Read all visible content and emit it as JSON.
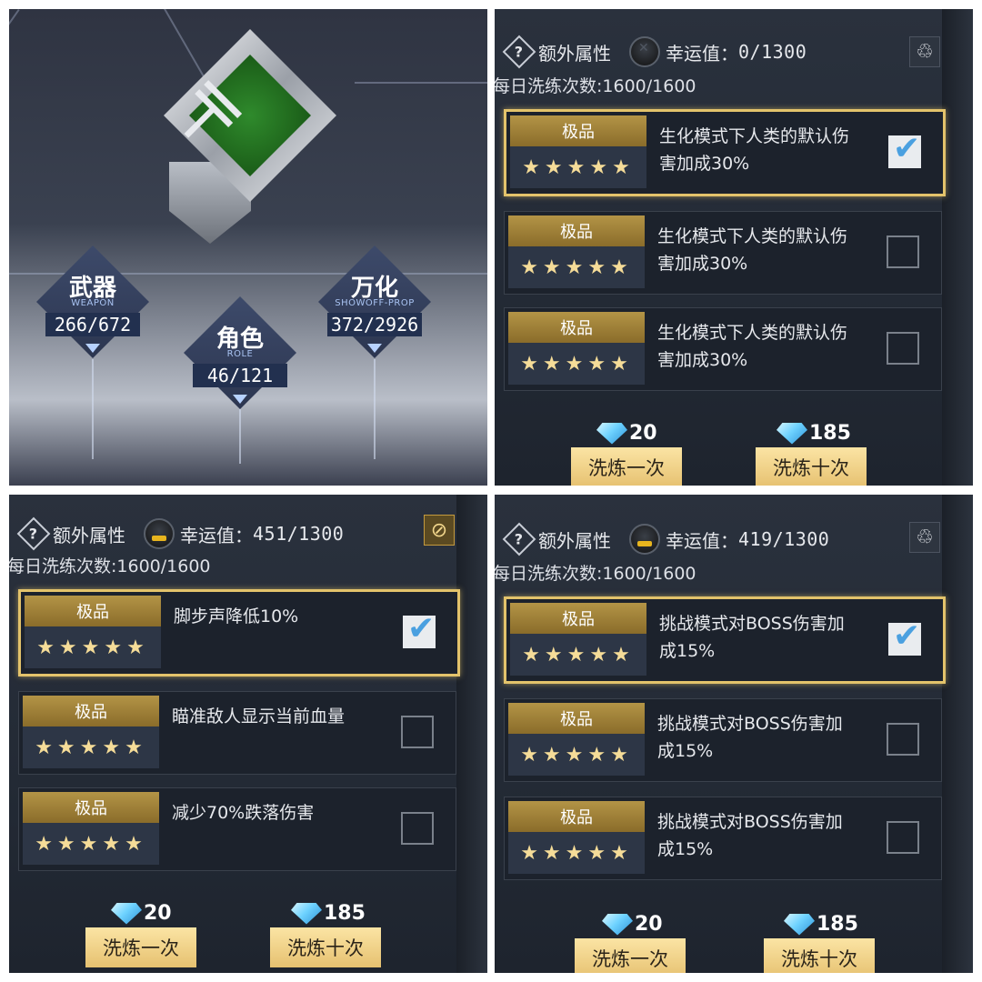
{
  "showcase": {
    "categories": [
      {
        "name": "武器",
        "subtitle": "WEAPON",
        "count": "266/672"
      },
      {
        "name": "角色",
        "subtitle": "ROLE",
        "count": "46/121"
      },
      {
        "name": "万化",
        "subtitle": "SHOWOFF-PROP",
        "count": "372/2926"
      }
    ]
  },
  "panels": [
    {
      "title": "额外属性",
      "luck_label": "幸运值：",
      "luck_value": "0/1300",
      "daily_text": "每日洗练次数:1600/1600",
      "corner_icon": "recycle-icon",
      "options": [
        {
          "grade": "极品",
          "stars": "★★★★★",
          "text": "生化模式下人类的默认伤害加成30%",
          "checked": true
        },
        {
          "grade": "极品",
          "stars": "★★★★★",
          "text": "生化模式下人类的默认伤害加成30%",
          "checked": false
        },
        {
          "grade": "极品",
          "stars": "★★★★★",
          "text": "生化模式下人类的默认伤害加成30%",
          "checked": false
        }
      ],
      "buttons": [
        {
          "cost": "20",
          "label": "洗炼一次"
        },
        {
          "cost": "185",
          "label": "洗炼十次"
        }
      ]
    },
    {
      "title": "额外属性",
      "luck_label": "幸运值：",
      "luck_value": "451/1300",
      "daily_text": "每日洗练次数:1600/1600",
      "corner_icon": "recycle-disabled-icon",
      "options": [
        {
          "grade": "极品",
          "stars": "★★★★★",
          "text": "脚步声降低10%",
          "checked": true
        },
        {
          "grade": "极品",
          "stars": "★★★★★",
          "text": "瞄准敌人显示当前血量",
          "checked": false
        },
        {
          "grade": "极品",
          "stars": "★★★★★",
          "text": "减少70%跌落伤害",
          "checked": false
        }
      ],
      "buttons": [
        {
          "cost": "20",
          "label": "洗炼一次"
        },
        {
          "cost": "185",
          "label": "洗炼十次"
        }
      ]
    },
    {
      "title": "额外属性",
      "luck_label": "幸运值：",
      "luck_value": "419/1300",
      "daily_text": "每日洗练次数:1600/1600",
      "corner_icon": "recycle-icon",
      "options": [
        {
          "grade": "极品",
          "stars": "★★★★★",
          "text": "挑战模式对BOSS伤害加成15%",
          "checked": true
        },
        {
          "grade": "极品",
          "stars": "★★★★★",
          "text": "挑战模式对BOSS伤害加成15%",
          "checked": false
        },
        {
          "grade": "极品",
          "stars": "★★★★★",
          "text": "挑战模式对BOSS伤害加成15%",
          "checked": false
        }
      ],
      "buttons": [
        {
          "cost": "20",
          "label": "洗炼一次"
        },
        {
          "cost": "185",
          "label": "洗炼十次"
        }
      ]
    }
  ],
  "colors": {
    "gold_accent": "#e3c36b",
    "badge_gold": "#b39446",
    "button_gold": "#f4d48a",
    "check_blue": "#4aa0e0"
  }
}
